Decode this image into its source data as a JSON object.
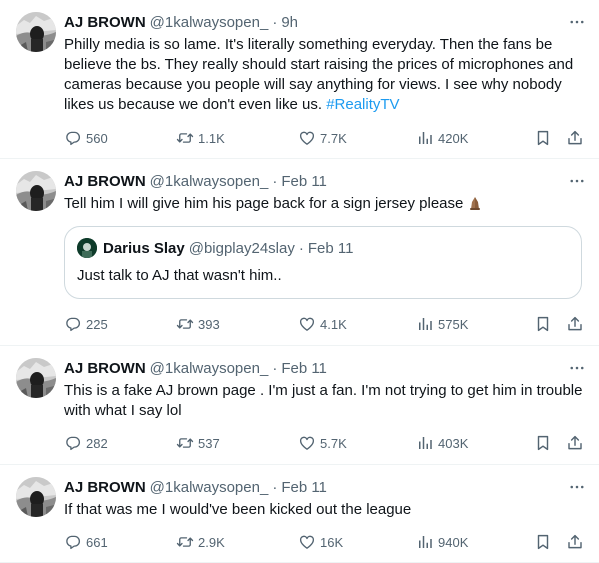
{
  "tweets": [
    {
      "name": "AJ BROWN",
      "handle": "@1kalwaysopen_",
      "dot": "·",
      "time": "9h",
      "text": "Philly media is so lame. It's literally something everyday. Then the fans be believe the bs. They really should start raising the prices of microphones and cameras because you people will say anything for views. I see why nobody likes us because we don't even like us. ",
      "hashtag": "#RealityTV",
      "replies": "560",
      "retweets": "1.1K",
      "likes": "7.7K",
      "views": "420K"
    },
    {
      "name": "AJ BROWN",
      "handle": "@1kalwaysopen_",
      "dot": "·",
      "time": "Feb 11",
      "text": "Tell him I will give him his page back for a sign jersey please",
      "emoji": "folded-hands-emoji",
      "quote": {
        "name": "Darius Slay",
        "handle": "@bigplay24slay",
        "dot": "·",
        "time": "Feb 11",
        "text": "Just talk to AJ that wasn't him.."
      },
      "replies": "225",
      "retweets": "393",
      "likes": "4.1K",
      "views": "575K"
    },
    {
      "name": "AJ BROWN",
      "handle": "@1kalwaysopen_",
      "dot": "·",
      "time": "Feb 11",
      "text": "This is a fake AJ brown page . I'm just a fan. I'm not trying to get him in trouble with what I say lol",
      "replies": "282",
      "retweets": "537",
      "likes": "5.7K",
      "views": "403K"
    },
    {
      "name": "AJ BROWN",
      "handle": "@1kalwaysopen_",
      "dot": "·",
      "time": "Feb 11",
      "text": "If that was me I would've been kicked out the league",
      "replies": "661",
      "retweets": "2.9K",
      "likes": "16K",
      "views": "940K"
    }
  ],
  "icons": {
    "reply": "reply-icon",
    "retweet": "retweet-icon",
    "like": "like-icon",
    "views": "views-icon",
    "bookmark": "bookmark-icon",
    "share": "share-icon",
    "more": "more-icon"
  },
  "colors": {
    "text": "#0f1419",
    "secondary": "#536471",
    "link": "#1d9bf0",
    "border": "#eff3f4"
  }
}
